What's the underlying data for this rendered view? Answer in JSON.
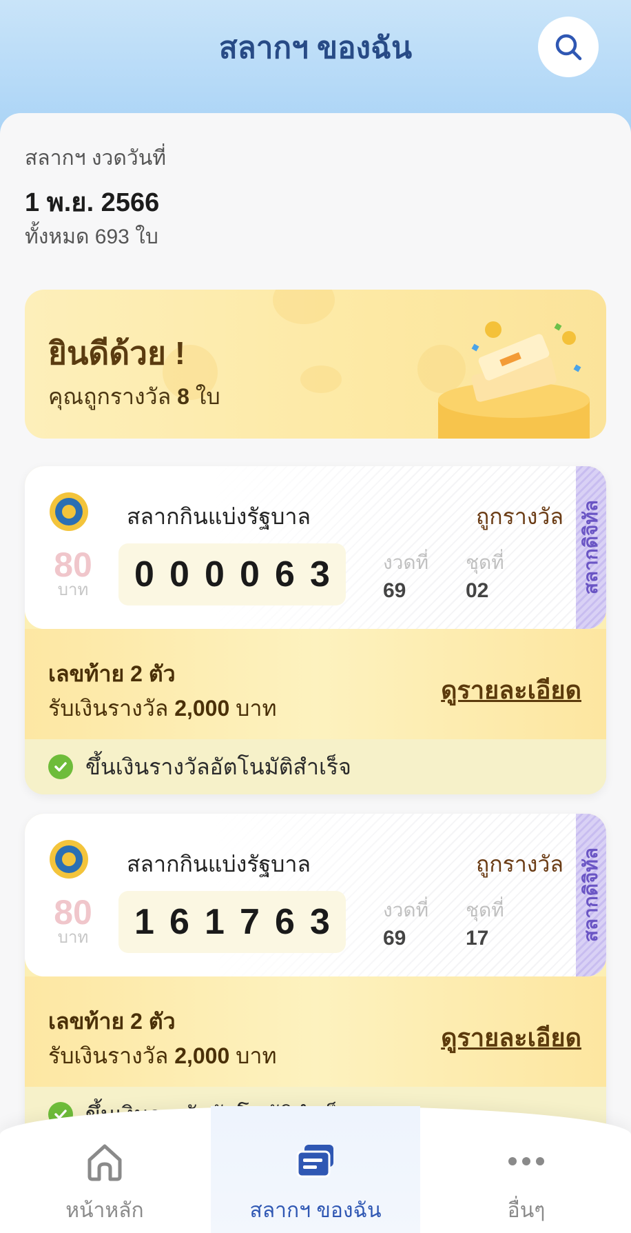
{
  "header": {
    "title": "สลากฯ ของฉัน"
  },
  "draw": {
    "label": "สลากฯ งวดวันที่",
    "date": "1 พ.ย. 2566",
    "total": "ทั้งหมด 693 ใบ"
  },
  "congrats": {
    "title": "ยินดีด้วย !",
    "sub_prefix": "คุณถูกรางวัล",
    "count": "8",
    "sub_suffix": "ใบ"
  },
  "tickets": [
    {
      "type": "สลากกินแบ่งรัฐบาล",
      "status": "ถูกรางวัล",
      "side_label": "สลากดิจิทัล",
      "price": "80",
      "price_unit": "บาท",
      "digits": [
        "0",
        "0",
        "0",
        "0",
        "6",
        "3"
      ],
      "draw_label": "งวดที่",
      "draw_value": "69",
      "set_label": "ชุดที่",
      "set_value": "02",
      "prize_title": "เลขท้าย 2 ตัว",
      "prize_prefix": "รับเงินรางวัล",
      "prize_amount": "2,000",
      "prize_unit": "บาท",
      "detail_link": "ดูรายละเอียด",
      "auto_status": "ขึ้นเงินรางวัลอัตโนมัติสำเร็จ"
    },
    {
      "type": "สลากกินแบ่งรัฐบาล",
      "status": "ถูกรางวัล",
      "side_label": "สลากดิจิทัล",
      "price": "80",
      "price_unit": "บาท",
      "digits": [
        "1",
        "6",
        "1",
        "7",
        "6",
        "3"
      ],
      "draw_label": "งวดที่",
      "draw_value": "69",
      "set_label": "ชุดที่",
      "set_value": "17",
      "prize_title": "เลขท้าย 2 ตัว",
      "prize_prefix": "รับเงินรางวัล",
      "prize_amount": "2,000",
      "prize_unit": "บาท",
      "detail_link": "ดูรายละเอียด",
      "auto_status": "ขึ้นเงินรางวัลอัตโนมัติสำเร็จ"
    }
  ],
  "nav": {
    "items": [
      {
        "label": "หน้าหลัก",
        "icon": "home-icon",
        "active": false
      },
      {
        "label": "สลากฯ ของฉัน",
        "icon": "ticket-wallet-icon",
        "active": true
      },
      {
        "label": "อื่นๆ",
        "icon": "more-icon",
        "active": false
      }
    ]
  },
  "colors": {
    "brand_blue": "#284b86",
    "active_nav": "#2f57b3",
    "gold_text": "#5b3a0c",
    "success_green": "#6ebc3a"
  }
}
